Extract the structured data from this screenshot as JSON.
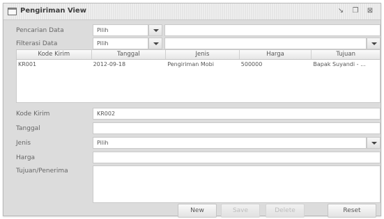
{
  "window": {
    "title": "Pengiriman View",
    "controls": [
      "minimize",
      "maximize",
      "close"
    ]
  },
  "search": {
    "label": "Pencarian Data",
    "select_value": "Pilih",
    "text_value": ""
  },
  "filter": {
    "label": "Filterasi Data",
    "select_value": "Pilih",
    "second_select_value": ""
  },
  "table": {
    "columns": [
      "Kode Kirim",
      "Tanggal",
      "Jenis",
      "Harga",
      "Tujuan"
    ],
    "rows": [
      [
        "KR001",
        "2012-09-18",
        "Pengiriman Mobi",
        "500000",
        "Bapak Suyandi - ..."
      ]
    ]
  },
  "form": {
    "kode_label": "Kode Kirim",
    "kode_value": "KR002",
    "tanggal_label": "Tanggal",
    "tanggal_value": "",
    "jenis_label": "Jenis",
    "jenis_value": "Pilih",
    "harga_label": "Harga",
    "harga_value": "",
    "tujuan_label": "Tujuan/Penerima",
    "tujuan_value": ""
  },
  "buttons": {
    "new": "New",
    "save": "Save",
    "delete": "Delete",
    "reset": "Reset"
  }
}
